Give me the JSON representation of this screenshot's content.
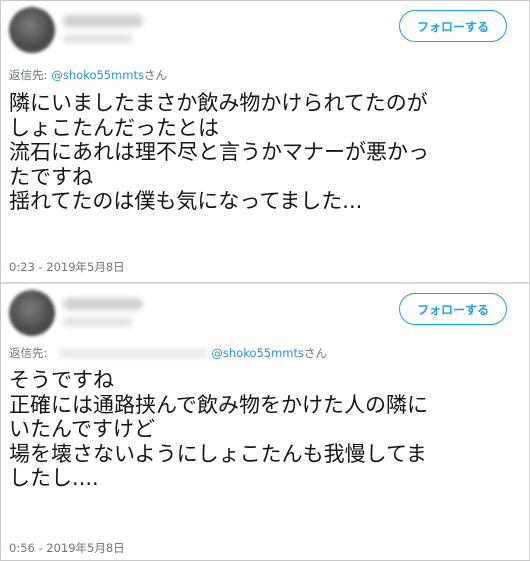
{
  "tweets": [
    {
      "follow_label": "フォローする",
      "reply_prefix": "返信先:",
      "reply_mention": "@shoko55mmts",
      "reply_suffix": "さん",
      "lines": [
        "隣にいましたまさか飲み物かけられてたのが",
        "しょこたんだったとは",
        "流石にあれは理不尽と言うかマナーが悪かっ",
        "たですね",
        "揺れてたのは僕も気になってました..."
      ],
      "timestamp": "0:23 - 2019年5月8日"
    },
    {
      "follow_label": "フォローする",
      "reply_prefix": "返信先:",
      "reply_mention": "@shoko55mmts",
      "reply_suffix": "さん",
      "lines": [
        "そうですね",
        "正確には通路挟んで飲み物をかけた人の隣に",
        "いたんですけど",
        "場を壊さないようにしょこたんも我慢してま",
        "したし...."
      ],
      "timestamp": "0:56 - 2019年5月8日"
    }
  ]
}
